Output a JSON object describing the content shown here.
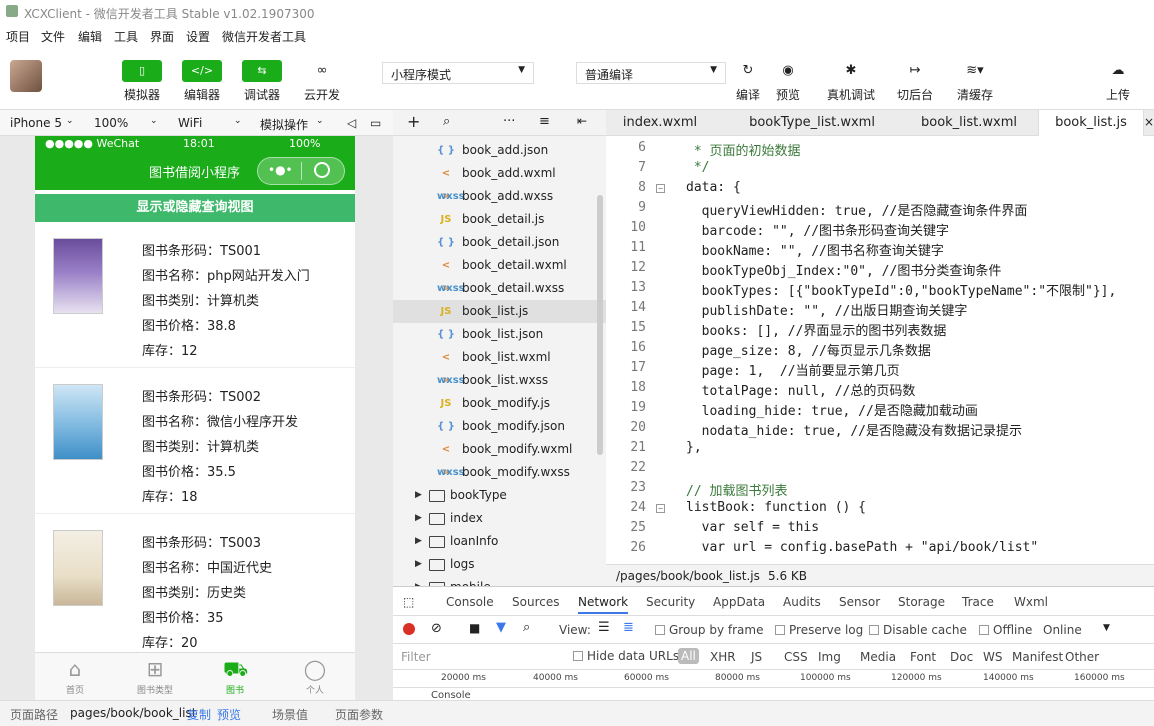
{
  "window": {
    "title": "XCXClient - 微信开发者工具 Stable v1.02.1907300"
  },
  "menu": [
    "项目",
    "文件",
    "编辑",
    "工具",
    "界面",
    "设置",
    "微信开发者工具"
  ],
  "toolbar": {
    "simulator": "模拟器",
    "editor": "编辑器",
    "debugger": "调试器",
    "cloud": "云开发",
    "mode": "小程序模式",
    "compile_mode": "普通编译",
    "compile": "编译",
    "preview": "预览",
    "device_debug": "真机调试",
    "background": "切后台",
    "clear_cache": "清缓存",
    "upload": "上传"
  },
  "device": {
    "model": "iPhone 5",
    "zoom": "100%",
    "network": "WiFi",
    "sim_op": "模拟操作"
  },
  "phone": {
    "status_left": "●●●●● WeChat",
    "time": "18:01",
    "battery": "100%",
    "nav_title": "图书借阅小程序",
    "toggle_label": "显示或隐藏查询视图",
    "books": [
      {
        "barcode": "图书条形码：TS001",
        "name": "图书名称：php网站开发入门",
        "type": "图书类别：计算机类",
        "price": "图书价格：38.8",
        "stock": "库存：12"
      },
      {
        "barcode": "图书条形码：TS002",
        "name": "图书名称：微信小程序开发",
        "type": "图书类别：计算机类",
        "price": "图书价格：35.5",
        "stock": "库存：18"
      },
      {
        "barcode": "图书条形码：TS003",
        "name": "图书名称：中国近代史",
        "type": "图书类别：历史类",
        "price": "图书价格：35",
        "stock": "库存：20"
      }
    ],
    "tabs": [
      "首页",
      "图书类型",
      "图书",
      "个人"
    ]
  },
  "files": [
    {
      "icon": "{ }",
      "name": "book_add.json"
    },
    {
      "icon": "< >",
      "name": "book_add.wxml"
    },
    {
      "icon": "wxss",
      "name": "book_add.wxss"
    },
    {
      "icon": "JS",
      "name": "book_detail.js"
    },
    {
      "icon": "{ }",
      "name": "book_detail.json"
    },
    {
      "icon": "< >",
      "name": "book_detail.wxml"
    },
    {
      "icon": "wxss",
      "name": "book_detail.wxss"
    },
    {
      "icon": "JS",
      "name": "book_list.js"
    },
    {
      "icon": "{ }",
      "name": "book_list.json"
    },
    {
      "icon": "< >",
      "name": "book_list.wxml"
    },
    {
      "icon": "wxss",
      "name": "book_list.wxss"
    },
    {
      "icon": "JS",
      "name": "book_modify.js"
    },
    {
      "icon": "{ }",
      "name": "book_modify.json"
    },
    {
      "icon": "< >",
      "name": "book_modify.wxml"
    },
    {
      "icon": "wxss",
      "name": "book_modify.wxss"
    }
  ],
  "folders": [
    "bookType",
    "index",
    "loanInfo",
    "logs",
    "mobile"
  ],
  "editor_tabs": [
    "index.wxml",
    "bookType_list.wxml",
    "book_list.wxml",
    "book_list.js"
  ],
  "code_lines": [
    {
      "n": "6",
      "t": " * 页面的初始数据"
    },
    {
      "n": "7",
      "t": " */"
    },
    {
      "n": "8",
      "t": "data: {"
    },
    {
      "n": "9",
      "t": "  queryViewHidden: true, //是否隐藏查询条件界面"
    },
    {
      "n": "10",
      "t": "  barcode: \"\", //图书条形码查询关键字"
    },
    {
      "n": "11",
      "t": "  bookName: \"\", //图书名称查询关键字"
    },
    {
      "n": "12",
      "t": "  bookTypeObj_Index:\"0\", //图书分类查询条件"
    },
    {
      "n": "13",
      "t": "  bookTypes: [{\"bookTypeId\":0,\"bookTypeName\":\"不限制\"}],"
    },
    {
      "n": "14",
      "t": "  publishDate: \"\", //出版日期查询关键字"
    },
    {
      "n": "15",
      "t": "  books: [], //界面显示的图书列表数据"
    },
    {
      "n": "16",
      "t": "  page_size: 8, //每页显示几条数据"
    },
    {
      "n": "17",
      "t": "  page: 1,  //当前要显示第几页"
    },
    {
      "n": "18",
      "t": "  totalPage: null, //总的页码数"
    },
    {
      "n": "19",
      "t": "  loading_hide: true, //是否隐藏加载动画"
    },
    {
      "n": "20",
      "t": "  nodata_hide: true, //是否隐藏没有数据记录提示"
    },
    {
      "n": "21",
      "t": "},"
    },
    {
      "n": "22",
      "t": ""
    },
    {
      "n": "23",
      "t": "// 加载图书列表"
    },
    {
      "n": "24",
      "t": "listBook: function () {"
    },
    {
      "n": "25",
      "t": "  var self = this"
    },
    {
      "n": "26",
      "t": "  var url = config.basePath + \"api/book/list\""
    }
  ],
  "file_path": "/pages/book/book_list.js",
  "file_size": "5.6 KB",
  "devtools": {
    "tabs": [
      "Console",
      "Sources",
      "Network",
      "Security",
      "AppData",
      "Audits",
      "Sensor",
      "Storage",
      "Trace",
      "Wxml"
    ],
    "options": [
      "View:",
      "Group by frame",
      "Preserve log",
      "Disable cache",
      "Offline",
      "Online"
    ],
    "filter_placeholder": "Filter",
    "hide_data": "Hide data URLs",
    "types": [
      "All",
      "XHR",
      "JS",
      "CSS",
      "Img",
      "Media",
      "Font",
      "Doc",
      "WS",
      "Manifest",
      "Other"
    ],
    "timeline": [
      "20000 ms",
      "40000 ms",
      "60000 ms",
      "80000 ms",
      "100000 ms",
      "120000 ms",
      "140000 ms",
      "160000 ms"
    ],
    "console": "Console"
  },
  "bottom": {
    "path_label": "页面路径",
    "path": "pages/book/book_list",
    "copy": "复制",
    "preview": "预览",
    "scene": "场景值",
    "params": "页面参数"
  }
}
